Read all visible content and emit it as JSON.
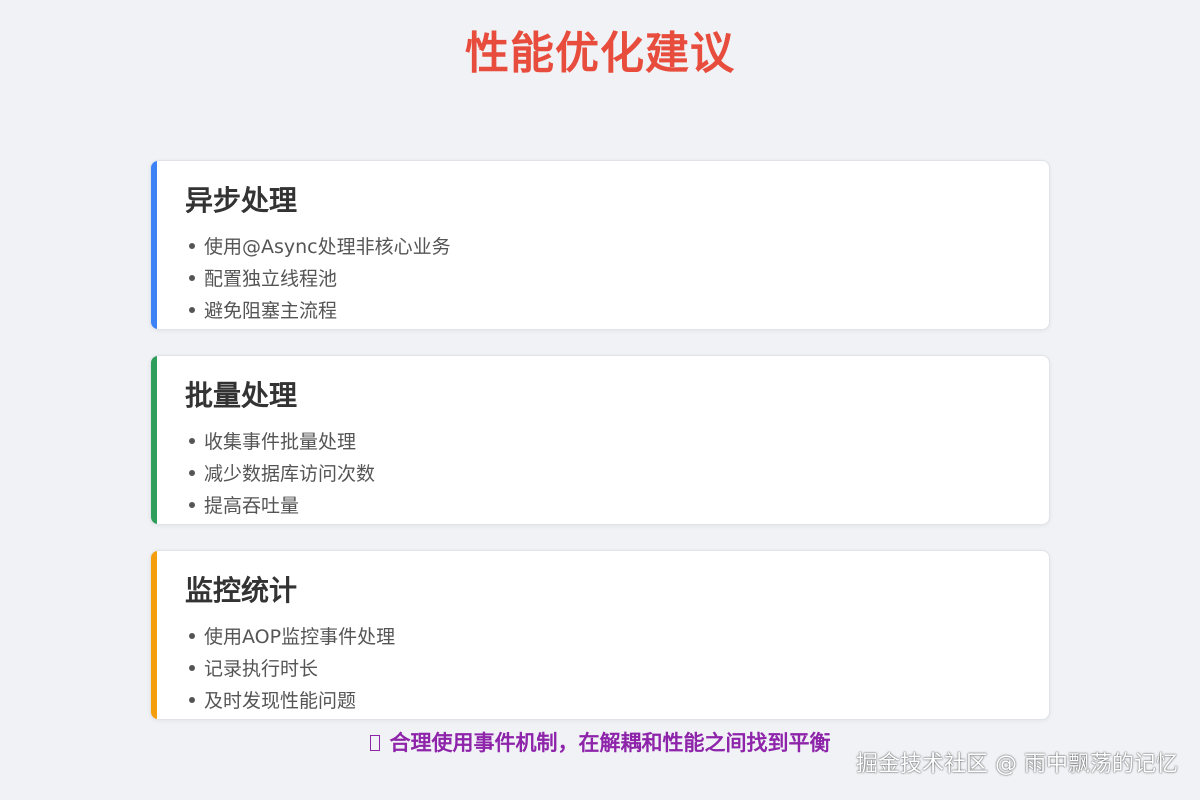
{
  "title": "性能优化建议",
  "cards": [
    {
      "heading": "异步处理",
      "accent_color": "#3b82f6",
      "items": [
        "使用@Async处理非核心业务",
        "配置独立线程池",
        "避免阻塞主流程"
      ]
    },
    {
      "heading": "批量处理",
      "accent_color": "#2e9e5b",
      "items": [
        "收集事件批量处理",
        "减少数据库访问次数",
        "提高吞吐量"
      ]
    },
    {
      "heading": "监控统计",
      "accent_color": "#f59e0b",
      "items": [
        "使用AOP监控事件处理",
        "记录执行时长",
        "及时发现性能问题"
      ]
    }
  ],
  "tip": {
    "icon": "lightbulb-icon",
    "text": "合理使用事件机制，在解耦和性能之间找到平衡"
  },
  "watermark": "掘金技术社区 @ 雨中飘荡的记忆",
  "colors": {
    "title": "#e74c3c",
    "tip": "#8e24aa",
    "background": "#f0f2f6"
  }
}
